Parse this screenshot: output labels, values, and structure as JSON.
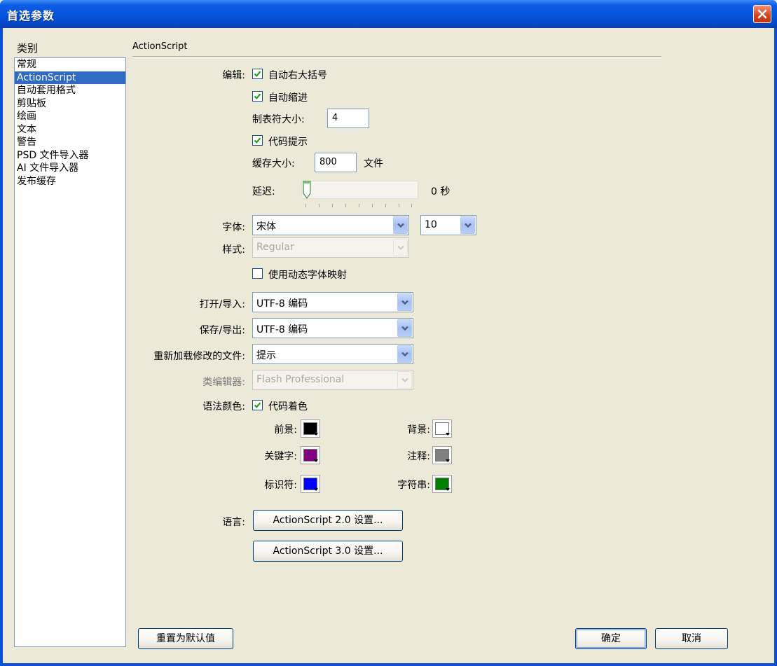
{
  "window": {
    "title": "首选参数"
  },
  "sidebar": {
    "label": "类别",
    "items": [
      "常规",
      "ActionScript",
      "自动套用格式",
      "剪贴板",
      "绘画",
      "文本",
      "警告",
      "PSD 文件导入器",
      "AI 文件导入器",
      "发布缓存"
    ],
    "selected": "ActionScript"
  },
  "section": {
    "title": "ActionScript"
  },
  "editing": {
    "label": "编辑:",
    "auto_brace": {
      "label": "自动右大括号",
      "checked": true
    },
    "auto_indent": {
      "label": "自动缩进",
      "checked": true
    },
    "tab_size_label": "制表符大小:",
    "tab_size_value": "4",
    "code_hints": {
      "label": "代码提示",
      "checked": true
    },
    "cache_size_label": "缓存大小:",
    "cache_size_value": "800",
    "cache_unit": "文件",
    "delay_label": "延迟:",
    "delay_value": "0 秒",
    "delay_slider_fraction": 0.0
  },
  "font": {
    "label": "字体:",
    "value": "宋体",
    "size_value": "10"
  },
  "style": {
    "label": "样式:",
    "value": "Regular"
  },
  "dynamic_font_mapping": {
    "label": "使用动态字体映射",
    "checked": false
  },
  "open_import": {
    "label": "打开/导入:",
    "value": "UTF-8 编码"
  },
  "save_export": {
    "label": "保存/导出:",
    "value": "UTF-8 编码"
  },
  "reload_modified": {
    "label": "重新加载修改的文件:",
    "value": "提示"
  },
  "class_editor": {
    "label": "类编辑器:",
    "value": "Flash Professional"
  },
  "syntax_coloring": {
    "label": "语法颜色:",
    "code_coloring": {
      "label": "代码着色",
      "checked": true
    },
    "foreground": {
      "label": "前景:",
      "color": "#000000"
    },
    "background": {
      "label": "背景:",
      "color": "#ffffff"
    },
    "keywords": {
      "label": "关键字:",
      "color": "#800080"
    },
    "comments": {
      "label": "注释:",
      "color": "#808080"
    },
    "identifiers": {
      "label": "标识符:",
      "color": "#0000ff"
    },
    "strings": {
      "label": "字符串:",
      "color": "#008000"
    }
  },
  "language": {
    "label": "语言:",
    "as2_button": "ActionScript 2.0 设置...",
    "as3_button": "ActionScript 3.0 设置..."
  },
  "footer": {
    "reset_button": "重置为默认值",
    "ok_button": "确定",
    "cancel_button": "取消"
  },
  "colors": {
    "titlebar": "#0553dd",
    "dialog_bg": "#ece9d8",
    "selection": "#316ac5",
    "close_button": "#d9411c"
  }
}
